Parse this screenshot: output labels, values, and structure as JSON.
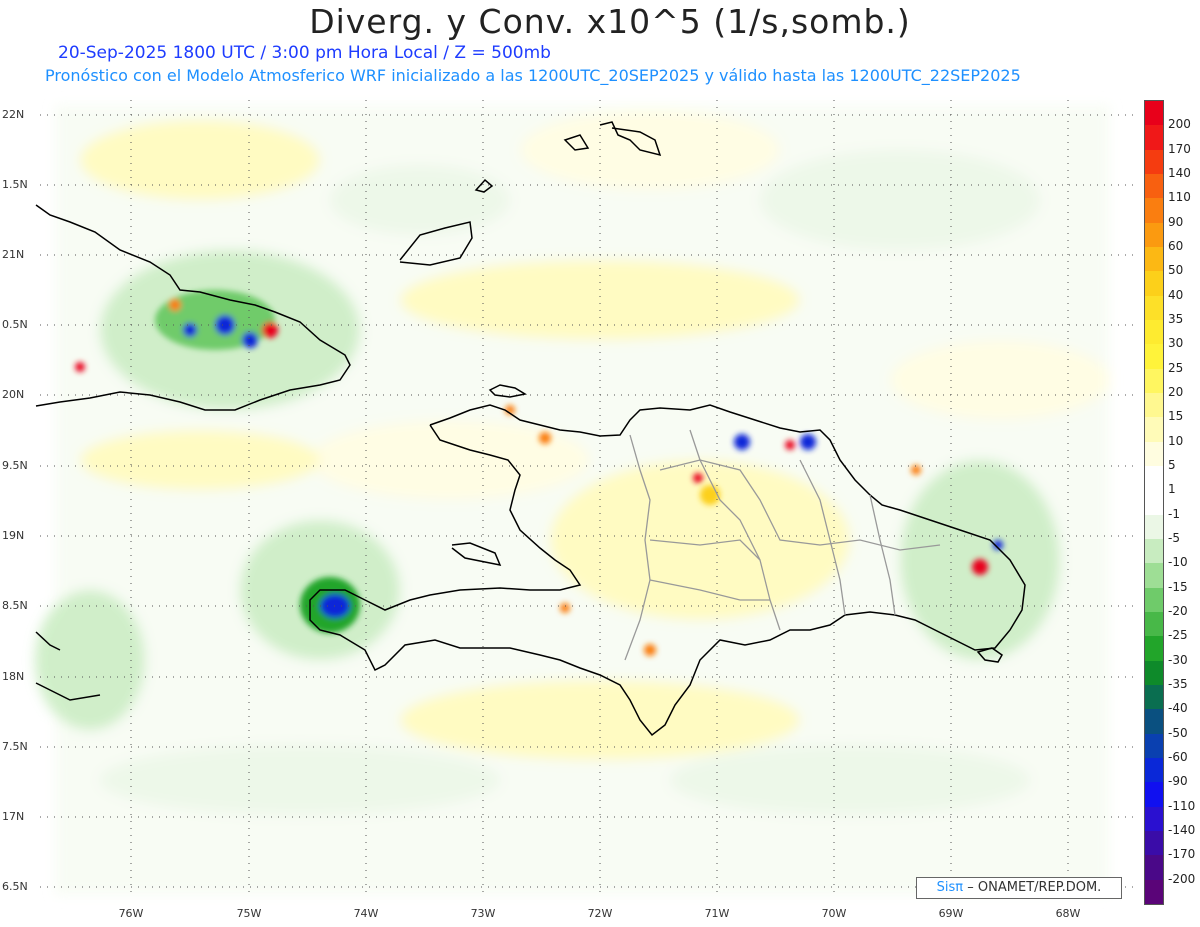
{
  "title": "Diverg. y Conv. x10^5 (1/s,somb.)",
  "subtitle_line1": "20-Sep-2025  1800 UTC / 3:00 pm Hora Local / Z = 500mb",
  "subtitle_line2": "Pronóstico con el Modelo Atmosferico WRF inicializado a las 1200UTC_20SEP2025 y válido hasta las  1200UTC_22SEP2025",
  "credit": {
    "logo": "Sisπ",
    "text": "– ONAMET/REP.DOM."
  },
  "latitude_labels": [
    "22N",
    "1.5N",
    "21N",
    "0.5N",
    "20N",
    "9.5N",
    "19N",
    "8.5N",
    "18N",
    "7.5N",
    "17N",
    "6.5N"
  ],
  "longitude_labels": [
    "76W",
    "75W",
    "74W",
    "73W",
    "72W",
    "71W",
    "70W",
    "69W",
    "68W"
  ],
  "colorbar": {
    "labels": [
      "200",
      "170",
      "140",
      "110",
      "90",
      "60",
      "50",
      "40",
      "35",
      "30",
      "25",
      "20",
      "15",
      "10",
      "5",
      "1",
      "-1",
      "-5",
      "-10",
      "-15",
      "-20",
      "-25",
      "-30",
      "-35",
      "-40",
      "-50",
      "-60",
      "-90",
      "-110",
      "-140",
      "-170",
      "-200"
    ],
    "colors": [
      "#e8001a",
      "#f01818",
      "#f53c10",
      "#f86010",
      "#fa7e10",
      "#fb9a10",
      "#fcb814",
      "#fcd01a",
      "#fde028",
      "#feeb30",
      "#fff33a",
      "#fff660",
      "#fff890",
      "#fffbb8",
      "#fffde0",
      "#ffffff",
      "#ffffff",
      "#ebf7e6",
      "#c8ecc0",
      "#9ede95",
      "#6fcb6a",
      "#48b848",
      "#22a52a",
      "#0e8a2a",
      "#0a6e50",
      "#0a5080",
      "#0a40b0",
      "#0a28d8",
      "#1010f0",
      "#2a10d0",
      "#3a0ca8",
      "#4a0888",
      "#5a0478"
    ]
  },
  "hotspots": [
    {
      "name": "eastern-cuba-cluster",
      "color": "#0a28d8"
    },
    {
      "name": "tiburon-peninsula",
      "color": "#0a28d8"
    },
    {
      "name": "cibao-north",
      "color": "#0a28d8"
    },
    {
      "name": "eastern-dr",
      "color": "#e8001a"
    }
  ]
}
